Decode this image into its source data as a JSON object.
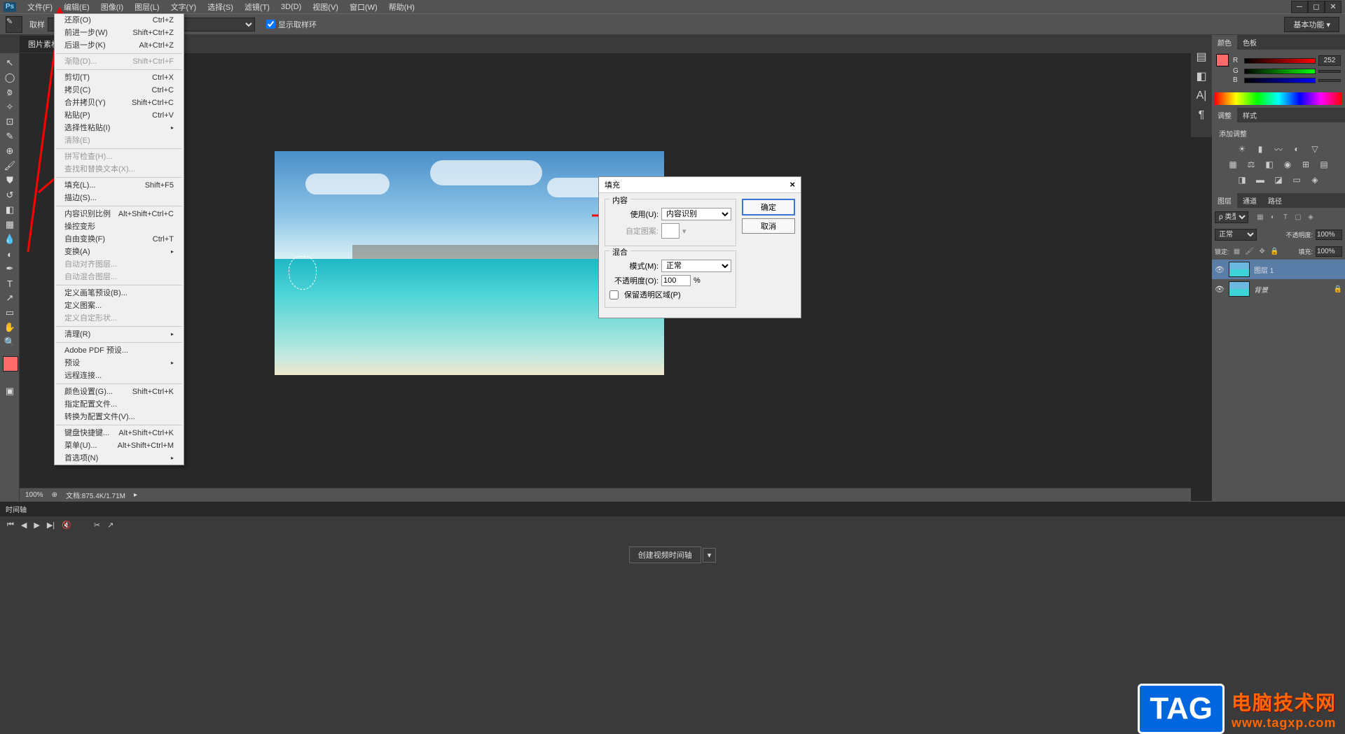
{
  "menubar": {
    "logo": "Ps",
    "items": [
      "文件(F)",
      "编辑(E)",
      "图像(I)",
      "图层(L)",
      "文字(Y)",
      "选择(S)",
      "滤镜(T)",
      "3D(D)",
      "视图(V)",
      "窗口(W)",
      "帮助(H)"
    ]
  },
  "options_bar": {
    "sample_label": "取样",
    "show_sample_ring": "显示取样环",
    "workspace": "基本功能"
  },
  "doc_tab": "图片素材",
  "edit_menu": [
    {
      "label": "还原(O)",
      "shortcut": "Ctrl+Z"
    },
    {
      "label": "前进一步(W)",
      "shortcut": "Shift+Ctrl+Z"
    },
    {
      "label": "后退一步(K)",
      "shortcut": "Alt+Ctrl+Z"
    },
    {
      "sep": true
    },
    {
      "label": "渐隐(D)...",
      "shortcut": "Shift+Ctrl+F",
      "disabled": true
    },
    {
      "sep": true
    },
    {
      "label": "剪切(T)",
      "shortcut": "Ctrl+X"
    },
    {
      "label": "拷贝(C)",
      "shortcut": "Ctrl+C"
    },
    {
      "label": "合并拷贝(Y)",
      "shortcut": "Shift+Ctrl+C"
    },
    {
      "label": "粘贴(P)",
      "shortcut": "Ctrl+V"
    },
    {
      "label": "选择性粘贴(I)",
      "shortcut": "",
      "submenu": true
    },
    {
      "label": "清除(E)",
      "shortcut": "",
      "disabled": true
    },
    {
      "sep": true
    },
    {
      "label": "拼写检查(H)...",
      "shortcut": "",
      "disabled": true
    },
    {
      "label": "查找和替换文本(X)...",
      "shortcut": "",
      "disabled": true
    },
    {
      "sep": true
    },
    {
      "label": "填充(L)...",
      "shortcut": "Shift+F5"
    },
    {
      "label": "描边(S)...",
      "shortcut": ""
    },
    {
      "sep": true
    },
    {
      "label": "内容识别比例",
      "shortcut": "Alt+Shift+Ctrl+C"
    },
    {
      "label": "操控变形",
      "shortcut": ""
    },
    {
      "label": "自由变换(F)",
      "shortcut": "Ctrl+T"
    },
    {
      "label": "变换(A)",
      "shortcut": "",
      "submenu": true
    },
    {
      "label": "自动对齐图层...",
      "shortcut": "",
      "disabled": true
    },
    {
      "label": "自动混合图层...",
      "shortcut": "",
      "disabled": true
    },
    {
      "sep": true
    },
    {
      "label": "定义画笔预设(B)...",
      "shortcut": ""
    },
    {
      "label": "定义图案...",
      "shortcut": ""
    },
    {
      "label": "定义自定形状...",
      "shortcut": "",
      "disabled": true
    },
    {
      "sep": true
    },
    {
      "label": "清理(R)",
      "shortcut": "",
      "submenu": true
    },
    {
      "sep": true
    },
    {
      "label": "Adobe PDF 预设...",
      "shortcut": ""
    },
    {
      "label": "预设",
      "shortcut": "",
      "submenu": true
    },
    {
      "label": "远程连接...",
      "shortcut": ""
    },
    {
      "sep": true
    },
    {
      "label": "颜色设置(G)...",
      "shortcut": "Shift+Ctrl+K"
    },
    {
      "label": "指定配置文件...",
      "shortcut": ""
    },
    {
      "label": "转换为配置文件(V)...",
      "shortcut": ""
    },
    {
      "sep": true
    },
    {
      "label": "键盘快捷键...",
      "shortcut": "Alt+Shift+Ctrl+K"
    },
    {
      "label": "菜单(U)...",
      "shortcut": "Alt+Shift+Ctrl+M"
    },
    {
      "label": "首选项(N)",
      "shortcut": "",
      "submenu": true
    }
  ],
  "fill_dialog": {
    "title": "填充",
    "content_legend": "内容",
    "use_label": "使用(U):",
    "use_value": "内容识别",
    "custom_pattern_label": "自定图案:",
    "blend_legend": "混合",
    "mode_label": "模式(M):",
    "mode_value": "正常",
    "opacity_label": "不透明度(O):",
    "opacity_value": "100",
    "opacity_unit": "%",
    "preserve_trans": "保留透明区域(P)",
    "ok": "确定",
    "cancel": "取消"
  },
  "color_panel": {
    "tabs": [
      "颜色",
      "色板"
    ],
    "r": "252",
    "g": "",
    "b": ""
  },
  "adjust_panel": {
    "tabs": [
      "调整",
      "样式"
    ],
    "label": "添加调整"
  },
  "layers_panel": {
    "tabs": [
      "图层",
      "通道",
      "路径"
    ],
    "kind": "ρ 类型",
    "blend": "正常",
    "opacity_label": "不透明度:",
    "opacity": "100%",
    "lock_label": "锁定:",
    "fill_label": "填充:",
    "fill": "100%",
    "layers": [
      {
        "name": "图层 1",
        "selected": true
      },
      {
        "name": "背景",
        "locked": true
      }
    ]
  },
  "status": {
    "zoom": "100%",
    "doc_info": "文档:875.4K/1.71M"
  },
  "timeline": {
    "tab": "时间轴",
    "create_btn": "创建视频时间轴"
  },
  "watermark": {
    "badge": "TAG",
    "line1": "电脑技术网",
    "line2": "www.tagxp.com"
  }
}
